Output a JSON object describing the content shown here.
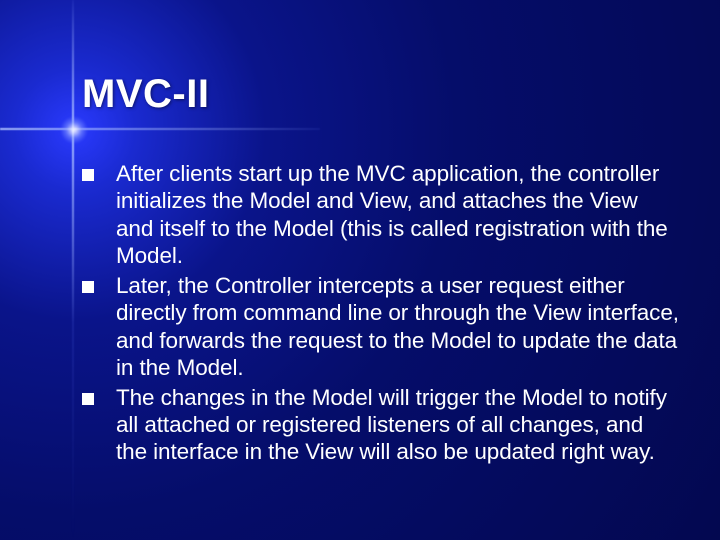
{
  "slide": {
    "title": "MVC-II",
    "bullets": [
      "After clients start up the MVC application, the controller initializes the Model and View, and attaches the View and itself to the Model (this is called registration with the Model.",
      "Later, the Controller intercepts a user request either directly from command line or through the View interface, and forwards the request to the Model to update the data in the Model.",
      "The changes in the Model will trigger the Model to notify all attached or registered listeners of all changes, and the interface in the View will also be updated right way."
    ]
  }
}
